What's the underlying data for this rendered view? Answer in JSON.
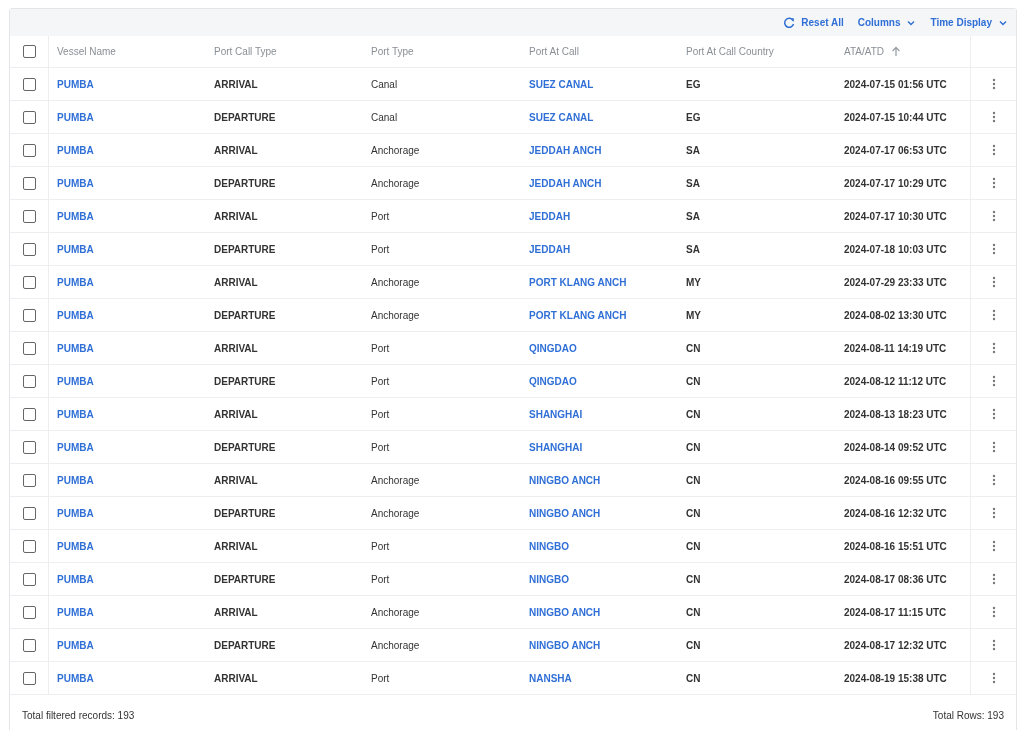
{
  "toolbar": {
    "reset": "Reset All",
    "menus": [
      "Columns",
      "Time Display"
    ]
  },
  "table": {
    "select_all_checked": false,
    "columns": [
      {
        "label": "Vessel Name",
        "sorted": false
      },
      {
        "label": "Port Call Type",
        "sorted": false
      },
      {
        "label": "Port Type",
        "sorted": false
      },
      {
        "label": "Port At Call",
        "sorted": false
      },
      {
        "label": "Port At Call Country",
        "sorted": false
      },
      {
        "label": "ATA/ATD",
        "sorted": true
      }
    ],
    "rows": [
      {
        "checked": false,
        "vessel": "PUMBA",
        "call_type": "ARRIVAL",
        "port_type": "Canal",
        "port": "SUEZ CANAL",
        "country": "EG",
        "time": "2024-07-15 01:56 UTC"
      },
      {
        "checked": false,
        "vessel": "PUMBA",
        "call_type": "DEPARTURE",
        "port_type": "Canal",
        "port": "SUEZ CANAL",
        "country": "EG",
        "time": "2024-07-15 10:44 UTC"
      },
      {
        "checked": false,
        "vessel": "PUMBA",
        "call_type": "ARRIVAL",
        "port_type": "Anchorage",
        "port": "JEDDAH ANCH",
        "country": "SA",
        "time": "2024-07-17 06:53 UTC"
      },
      {
        "checked": false,
        "vessel": "PUMBA",
        "call_type": "DEPARTURE",
        "port_type": "Anchorage",
        "port": "JEDDAH ANCH",
        "country": "SA",
        "time": "2024-07-17 10:29 UTC"
      },
      {
        "checked": false,
        "vessel": "PUMBA",
        "call_type": "ARRIVAL",
        "port_type": "Port",
        "port": "JEDDAH",
        "country": "SA",
        "time": "2024-07-17 10:30 UTC"
      },
      {
        "checked": false,
        "vessel": "PUMBA",
        "call_type": "DEPARTURE",
        "port_type": "Port",
        "port": "JEDDAH",
        "country": "SA",
        "time": "2024-07-18 10:03 UTC"
      },
      {
        "checked": false,
        "vessel": "PUMBA",
        "call_type": "ARRIVAL",
        "port_type": "Anchorage",
        "port": "PORT KLANG ANCH",
        "country": "MY",
        "time": "2024-07-29 23:33 UTC"
      },
      {
        "checked": false,
        "vessel": "PUMBA",
        "call_type": "DEPARTURE",
        "port_type": "Anchorage",
        "port": "PORT KLANG ANCH",
        "country": "MY",
        "time": "2024-08-02 13:30 UTC"
      },
      {
        "checked": false,
        "vessel": "PUMBA",
        "call_type": "ARRIVAL",
        "port_type": "Port",
        "port": "QINGDAO",
        "country": "CN",
        "time": "2024-08-11 14:19 UTC"
      },
      {
        "checked": false,
        "vessel": "PUMBA",
        "call_type": "DEPARTURE",
        "port_type": "Port",
        "port": "QINGDAO",
        "country": "CN",
        "time": "2024-08-12 11:12 UTC"
      },
      {
        "checked": false,
        "vessel": "PUMBA",
        "call_type": "ARRIVAL",
        "port_type": "Port",
        "port": "SHANGHAI",
        "country": "CN",
        "time": "2024-08-13 18:23 UTC"
      },
      {
        "checked": false,
        "vessel": "PUMBA",
        "call_type": "DEPARTURE",
        "port_type": "Port",
        "port": "SHANGHAI",
        "country": "CN",
        "time": "2024-08-14 09:52 UTC"
      },
      {
        "checked": false,
        "vessel": "PUMBA",
        "call_type": "ARRIVAL",
        "port_type": "Anchorage",
        "port": "NINGBO ANCH",
        "country": "CN",
        "time": "2024-08-16 09:55 UTC"
      },
      {
        "checked": false,
        "vessel": "PUMBA",
        "call_type": "DEPARTURE",
        "port_type": "Anchorage",
        "port": "NINGBO ANCH",
        "country": "CN",
        "time": "2024-08-16 12:32 UTC"
      },
      {
        "checked": false,
        "vessel": "PUMBA",
        "call_type": "ARRIVAL",
        "port_type": "Port",
        "port": "NINGBO",
        "country": "CN",
        "time": "2024-08-16 15:51 UTC"
      },
      {
        "checked": false,
        "vessel": "PUMBA",
        "call_type": "DEPARTURE",
        "port_type": "Port",
        "port": "NINGBO",
        "country": "CN",
        "time": "2024-08-17 08:36 UTC"
      },
      {
        "checked": false,
        "vessel": "PUMBA",
        "call_type": "ARRIVAL",
        "port_type": "Anchorage",
        "port": "NINGBO ANCH",
        "country": "CN",
        "time": "2024-08-17 11:15 UTC"
      },
      {
        "checked": false,
        "vessel": "PUMBA",
        "call_type": "DEPARTURE",
        "port_type": "Anchorage",
        "port": "NINGBO ANCH",
        "country": "CN",
        "time": "2024-08-17 12:32 UTC"
      },
      {
        "checked": false,
        "vessel": "PUMBA",
        "call_type": "ARRIVAL",
        "port_type": "Port",
        "port": "NANSHA",
        "country": "CN",
        "time": "2024-08-19 15:38 UTC"
      }
    ]
  },
  "footer": {
    "filtered": "Total filtered records: 193",
    "total": "Total Rows: 193"
  }
}
